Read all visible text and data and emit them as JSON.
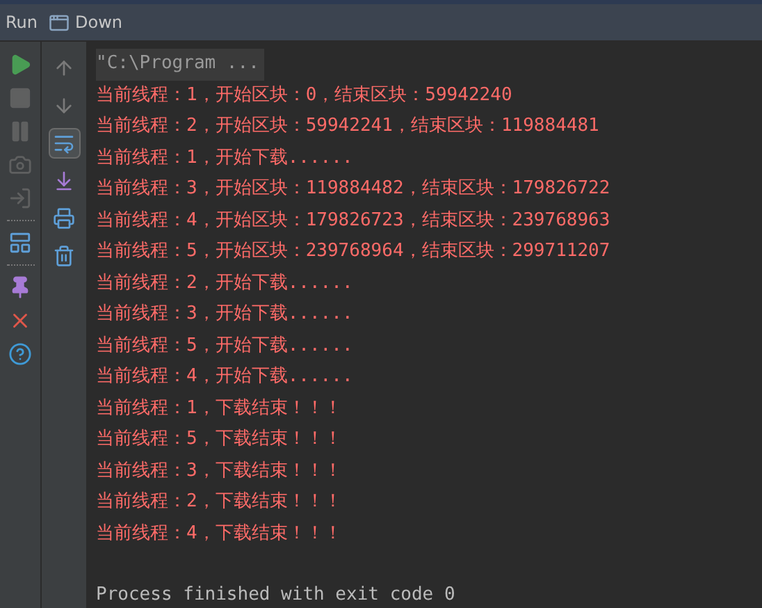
{
  "header": {
    "label": "Run",
    "config_name": "Down"
  },
  "run_toolbar": [
    {
      "kind": "run",
      "disabled": false
    },
    {
      "kind": "stop",
      "disabled": true
    },
    {
      "kind": "pause",
      "disabled": true
    },
    {
      "kind": "camera",
      "disabled": true
    },
    {
      "kind": "exit",
      "disabled": true
    },
    {
      "kind": "layout",
      "disabled": false,
      "separator_before": true
    },
    {
      "kind": "pin",
      "disabled": false,
      "separator_before": true
    },
    {
      "kind": "close",
      "disabled": false
    },
    {
      "kind": "help",
      "disabled": false
    }
  ],
  "console_toolbar": [
    {
      "kind": "up",
      "selected": false
    },
    {
      "kind": "down",
      "selected": false
    },
    {
      "kind": "wrap",
      "selected": true
    },
    {
      "kind": "scroll-end",
      "selected": false
    },
    {
      "kind": "print",
      "selected": false
    },
    {
      "kind": "clear",
      "selected": false
    }
  ],
  "console": [
    {
      "kind": "command",
      "text": "\"C:\\Program ..."
    },
    {
      "kind": "error",
      "text": "当前线程：1，开始区块：0，结束区块：59942240"
    },
    {
      "kind": "error",
      "text": "当前线程：2，开始区块：59942241，结束区块：119884481"
    },
    {
      "kind": "error",
      "text": "当前线程：1，开始下载......"
    },
    {
      "kind": "error",
      "text": "当前线程：3，开始区块：119884482，结束区块：179826722"
    },
    {
      "kind": "error",
      "text": "当前线程：4，开始区块：179826723，结束区块：239768963"
    },
    {
      "kind": "error",
      "text": "当前线程：5，开始区块：239768964，结束区块：299711207"
    },
    {
      "kind": "error",
      "text": "当前线程：2，开始下载......"
    },
    {
      "kind": "error",
      "text": "当前线程：3，开始下载......"
    },
    {
      "kind": "error",
      "text": "当前线程：5，开始下载......"
    },
    {
      "kind": "error",
      "text": "当前线程：4，开始下载......"
    },
    {
      "kind": "error",
      "text": "当前线程：1，下载结束！！！"
    },
    {
      "kind": "error",
      "text": "当前线程：5，下载结束！！！"
    },
    {
      "kind": "error",
      "text": "当前线程：3，下载结束！！！"
    },
    {
      "kind": "error",
      "text": "当前线程：2，下载结束！！！"
    },
    {
      "kind": "error",
      "text": "当前线程：4，下载结束！！！"
    },
    {
      "kind": "system",
      "text": "Process finished with exit code 0"
    }
  ]
}
